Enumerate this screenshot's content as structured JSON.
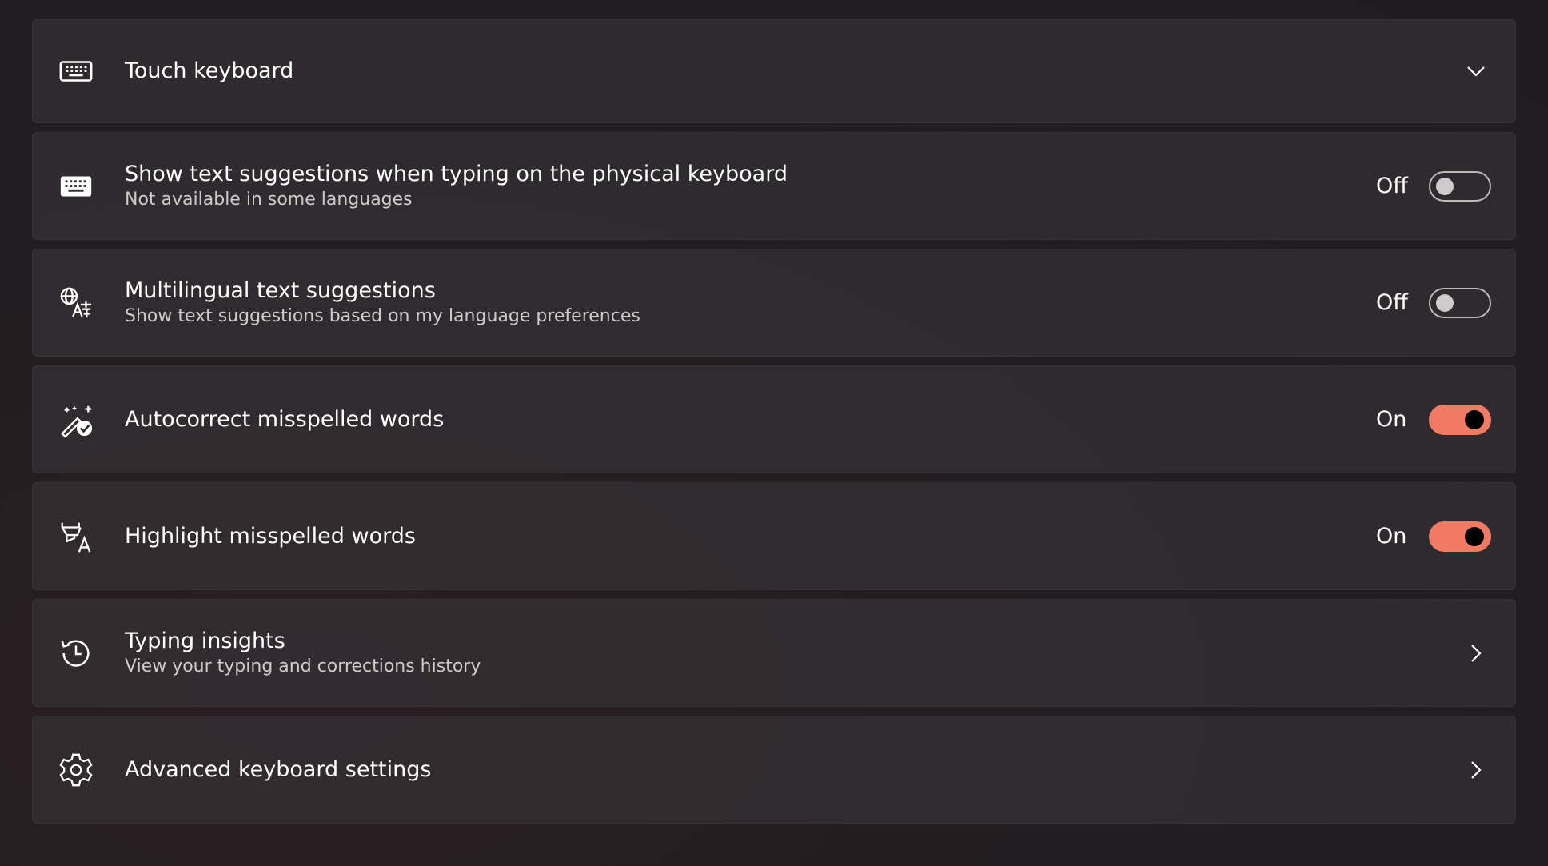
{
  "settings": [
    {
      "id": "touch-keyboard",
      "title": "Touch keyboard",
      "subtitle": "",
      "icon": "touch-keyboard-icon",
      "control": "chevron-down"
    },
    {
      "id": "text-suggestions-physical",
      "title": "Show text suggestions when typing on the physical keyboard",
      "subtitle": "Not available in some languages",
      "icon": "keyboard-icon",
      "control": "toggle",
      "state": "Off"
    },
    {
      "id": "multilingual-suggestions",
      "title": "Multilingual text suggestions",
      "subtitle": "Show text suggestions based on my language preferences",
      "icon": "language-icon",
      "control": "toggle",
      "state": "Off"
    },
    {
      "id": "autocorrect",
      "title": "Autocorrect misspelled words",
      "subtitle": "",
      "icon": "autocorrect-icon",
      "control": "toggle",
      "state": "On"
    },
    {
      "id": "highlight-misspelled",
      "title": "Highlight misspelled words",
      "subtitle": "",
      "icon": "highlight-text-icon",
      "control": "toggle",
      "state": "On"
    },
    {
      "id": "typing-insights",
      "title": "Typing insights",
      "subtitle": "View your typing and corrections history",
      "icon": "history-icon",
      "control": "chevron-right"
    },
    {
      "id": "advanced-keyboard",
      "title": "Advanced keyboard settings",
      "subtitle": "",
      "icon": "gear-icon",
      "control": "chevron-right"
    }
  ],
  "colors": {
    "accent": "#f07a63",
    "card": "#3a363a",
    "background": "#221d20"
  }
}
